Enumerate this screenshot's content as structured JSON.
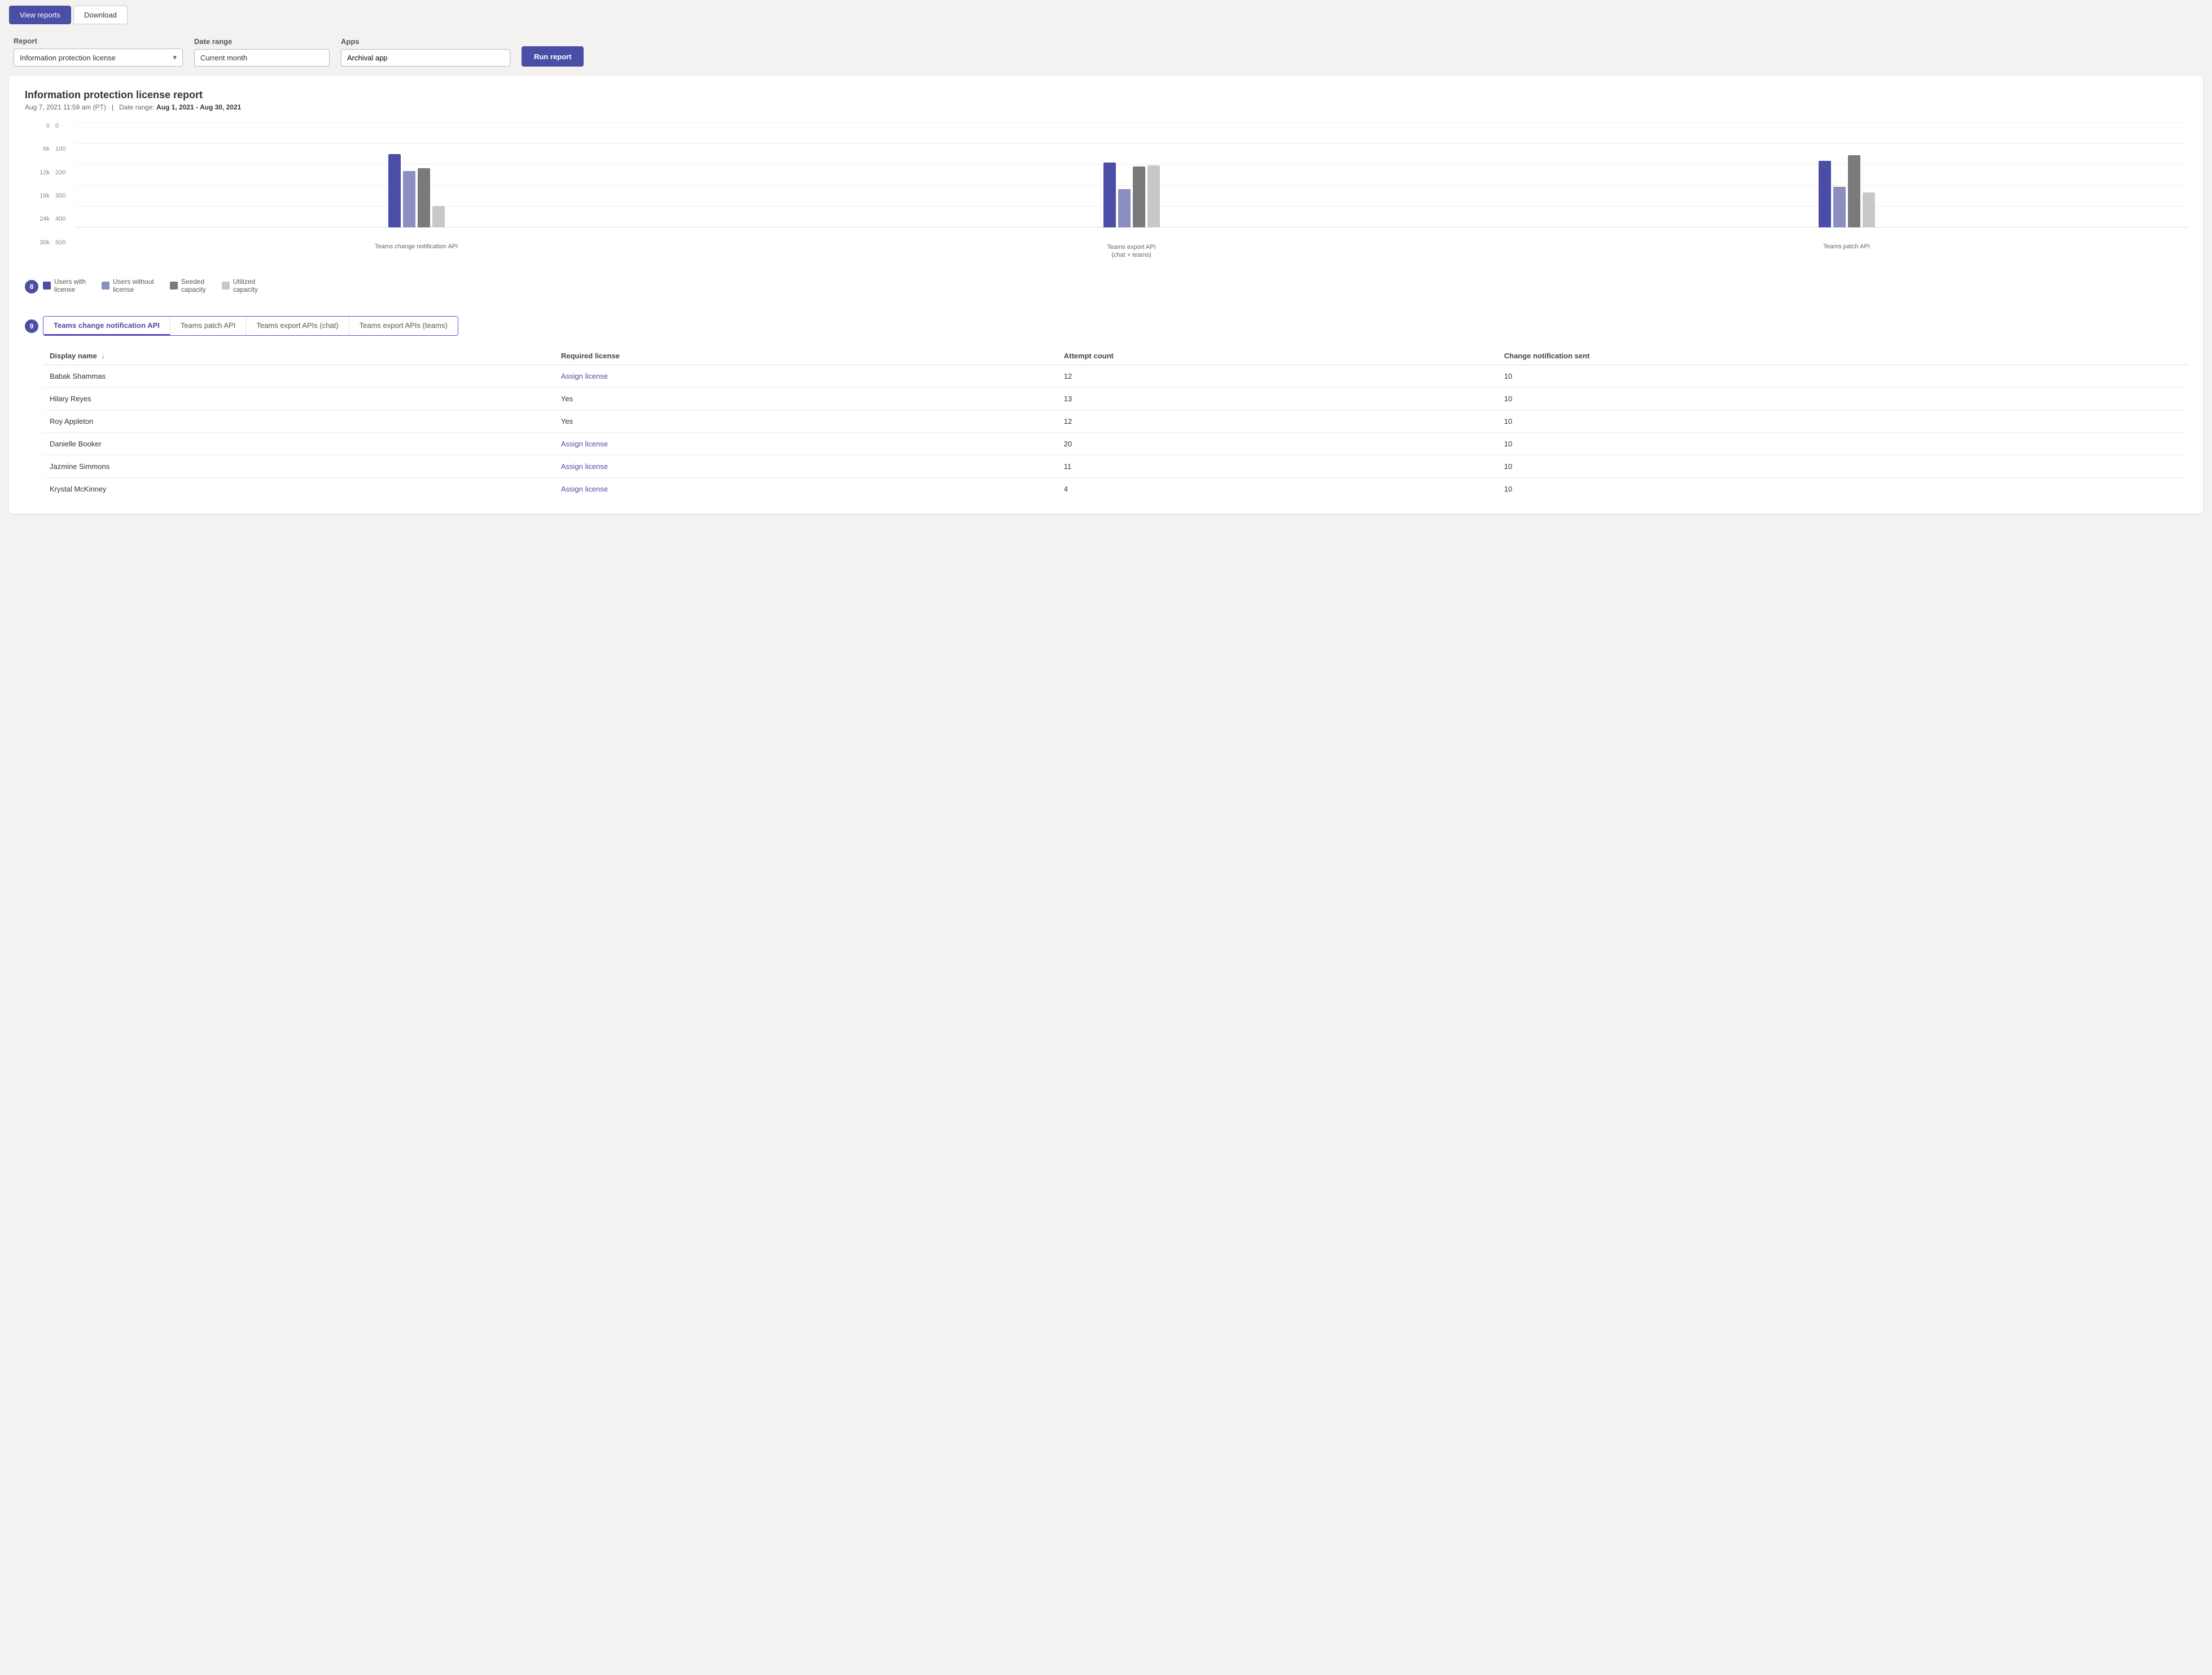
{
  "toolbar": {
    "view_reports_label": "View reports",
    "download_label": "Download"
  },
  "filters": {
    "report_label": "Report",
    "report_value": "Information protection license",
    "date_range_label": "Date range",
    "date_range_value": "Current month",
    "apps_label": "Apps",
    "apps_value": "Archival app",
    "run_report_label": "Run report"
  },
  "report": {
    "title": "Information protection license report",
    "meta_date": "Aug 7, 2021 11:59 am (PT)",
    "meta_separator": "|",
    "meta_range_label": "Date range:",
    "meta_range_value": "Aug 1, 2021 - Aug 30, 2021",
    "chart": {
      "y_axis_left": [
        "0",
        "6k",
        "12k",
        "18k",
        "24k",
        "30k"
      ],
      "y_axis_right": [
        "0",
        "100",
        "200",
        "300",
        "400",
        "500"
      ],
      "groups": [
        {
          "label": "Teams change notification API",
          "bars": [
            {
              "type": "dark-blue",
              "height": 130
            },
            {
              "type": "mid-blue",
              "height": 100
            },
            {
              "type": "dark-gray",
              "height": 105
            },
            {
              "type": "light-gray",
              "height": 38
            }
          ]
        },
        {
          "label": "Teams export API\n(chat + teams)",
          "bars": [
            {
              "type": "dark-blue",
              "height": 115
            },
            {
              "type": "mid-blue",
              "height": 68
            },
            {
              "type": "dark-gray",
              "height": 108
            },
            {
              "type": "light-gray",
              "height": 110
            }
          ]
        },
        {
          "label": "Teams patch API",
          "bars": [
            {
              "type": "dark-blue",
              "height": 118
            },
            {
              "type": "mid-blue",
              "height": 72
            },
            {
              "type": "dark-gray",
              "height": 128
            },
            {
              "type": "light-gray",
              "height": 62
            }
          ]
        }
      ]
    },
    "legend": [
      {
        "type": "dark-blue",
        "label": "Users with license"
      },
      {
        "type": "mid-blue",
        "label": "Users without license"
      },
      {
        "type": "dark-gray",
        "label": "Seeded capacity"
      },
      {
        "type": "light-gray",
        "label": "Utilized capacity"
      }
    ],
    "step8_label": "8",
    "step9_label": "9",
    "tabs": [
      {
        "label": "Teams change notification API",
        "active": true
      },
      {
        "label": "Teams patch API",
        "active": false
      },
      {
        "label": "Teams export APIs (chat)",
        "active": false
      },
      {
        "label": "Teams export APIs (teams)",
        "active": false
      }
    ],
    "table": {
      "columns": [
        {
          "label": "Display name",
          "sort": true
        },
        {
          "label": "Required license",
          "sort": false
        },
        {
          "label": "Attempt count",
          "sort": false
        },
        {
          "label": "Change notification sent",
          "sort": false
        }
      ],
      "rows": [
        {
          "name": "Babak Shammas",
          "license": "Assign license",
          "is_link": true,
          "attempts": "12",
          "notifications": "10"
        },
        {
          "name": "Hilary Reyes",
          "license": "Yes",
          "is_link": false,
          "attempts": "13",
          "notifications": "10"
        },
        {
          "name": "Roy Appleton",
          "license": "Yes",
          "is_link": false,
          "attempts": "12",
          "notifications": "10"
        },
        {
          "name": "Danielle Booker",
          "license": "Assign license",
          "is_link": true,
          "attempts": "20",
          "notifications": "10"
        },
        {
          "name": "Jazmine Simmons",
          "license": "Assign license",
          "is_link": true,
          "attempts": "11",
          "notifications": "10"
        },
        {
          "name": "Krystal McKinney",
          "license": "Assign license",
          "is_link": true,
          "attempts": "4",
          "notifications": "10"
        }
      ]
    }
  }
}
